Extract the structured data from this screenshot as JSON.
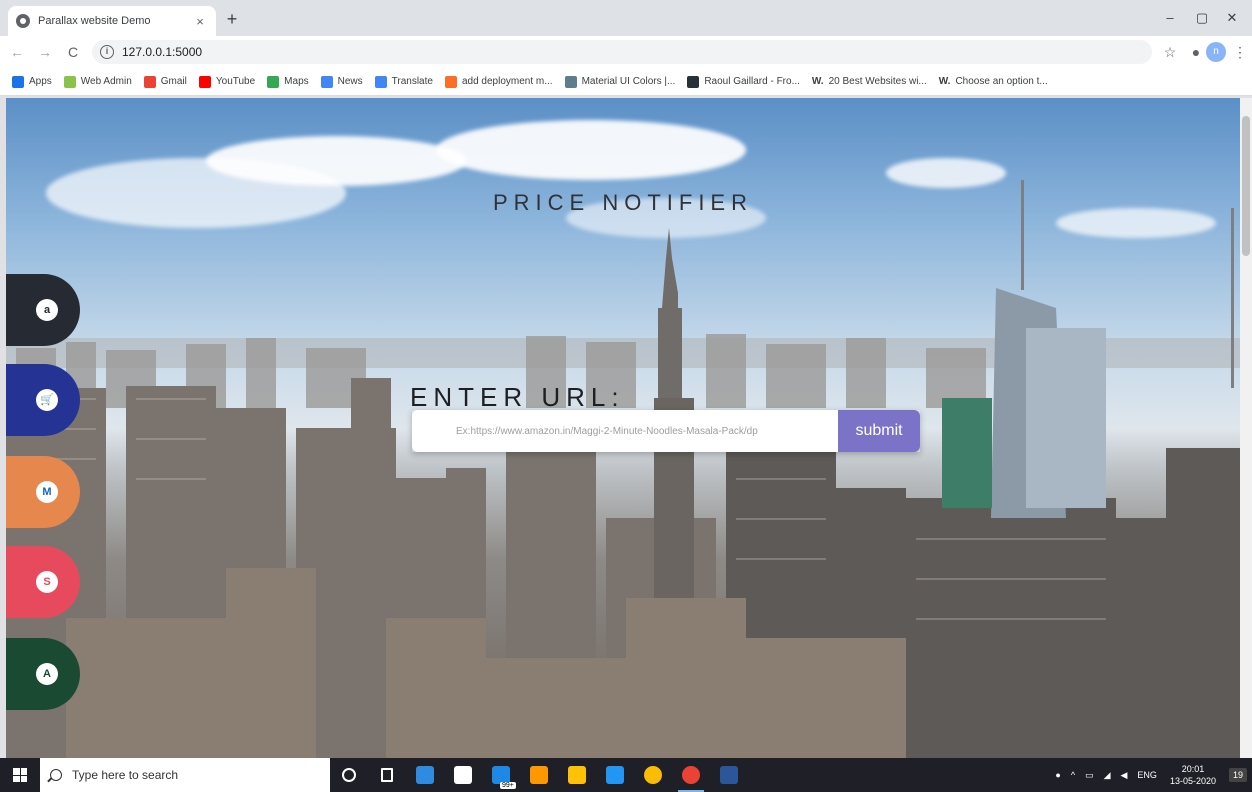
{
  "browser": {
    "tab_title": "Parallax website Demo",
    "tab_close": "×",
    "new_tab": "+",
    "window_minimize": "–",
    "window_restore": "▢",
    "window_close": "✕",
    "url": "127.0.0.1:5000",
    "back": "←",
    "forward": "→",
    "reload": "C",
    "star": "☆",
    "menu": "⋮",
    "profile_initial": "n"
  },
  "bookmarks": [
    {
      "label": "Apps",
      "color": "#1a73e8"
    },
    {
      "label": "Web Admin",
      "color": "#8bc34a"
    },
    {
      "label": "Gmail",
      "color": "#ea4335"
    },
    {
      "label": "YouTube",
      "color": "#ff0000"
    },
    {
      "label": "Maps",
      "color": "#34a853"
    },
    {
      "label": "News",
      "color": "#4285f4"
    },
    {
      "label": "Translate",
      "color": "#4285f4"
    },
    {
      "label": "add deployment m...",
      "color": "#fc6d26"
    },
    {
      "label": "Material UI Colors |...",
      "color": "#607d8b"
    },
    {
      "label": "Raoul Gaillard - Fro...",
      "color": "#263238"
    },
    {
      "label": "20 Best Websites wi...",
      "color": "#000000",
      "prefix": "W."
    },
    {
      "label": "Choose an option t...",
      "color": "#000000",
      "prefix": "W."
    }
  ],
  "page": {
    "heading": "PRICE NOTIFIER",
    "enter_label": "ENTER URL:",
    "input_placeholder": "Ex:https://www.amazon.in/Maggi-2-Minute-Noodles-Masala-Pack/dp",
    "submit_label": "submit"
  },
  "side_tabs": [
    {
      "letter": "a",
      "bg": "#252a33",
      "fg": "#252a33"
    },
    {
      "letter": "🛒",
      "bg": "#253394",
      "fg": "#f57c00"
    },
    {
      "letter": "M",
      "bg": "#e6874e",
      "fg": "#1565c0"
    },
    {
      "letter": "S",
      "bg": "#e64a5c",
      "fg": "#e64a5c"
    },
    {
      "letter": "A",
      "bg": "#1b4a33",
      "fg": "#1b4a33"
    }
  ],
  "taskbar": {
    "search_placeholder": "Type here to search",
    "badge_count": "99+",
    "tray_language": "ENG",
    "time": "20:01",
    "date": "13-05-2020",
    "notification_count": "19"
  },
  "taskbar_apps": [
    {
      "name": "cortana",
      "color": "#ffffff"
    },
    {
      "name": "task-view",
      "color": "#ffffff"
    },
    {
      "name": "edge",
      "color": "#2f8be0"
    },
    {
      "name": "store",
      "color": "#ffffff"
    },
    {
      "name": "weather",
      "color": "#1e88e5"
    },
    {
      "name": "sublime",
      "color": "#ff9800"
    },
    {
      "name": "file-explorer",
      "color": "#ffc107"
    },
    {
      "name": "vscode",
      "color": "#2196f3"
    },
    {
      "name": "chrome",
      "color": "#fbbc05"
    },
    {
      "name": "chrome-active",
      "color": "#ea4335"
    },
    {
      "name": "word",
      "color": "#2b579a"
    }
  ]
}
